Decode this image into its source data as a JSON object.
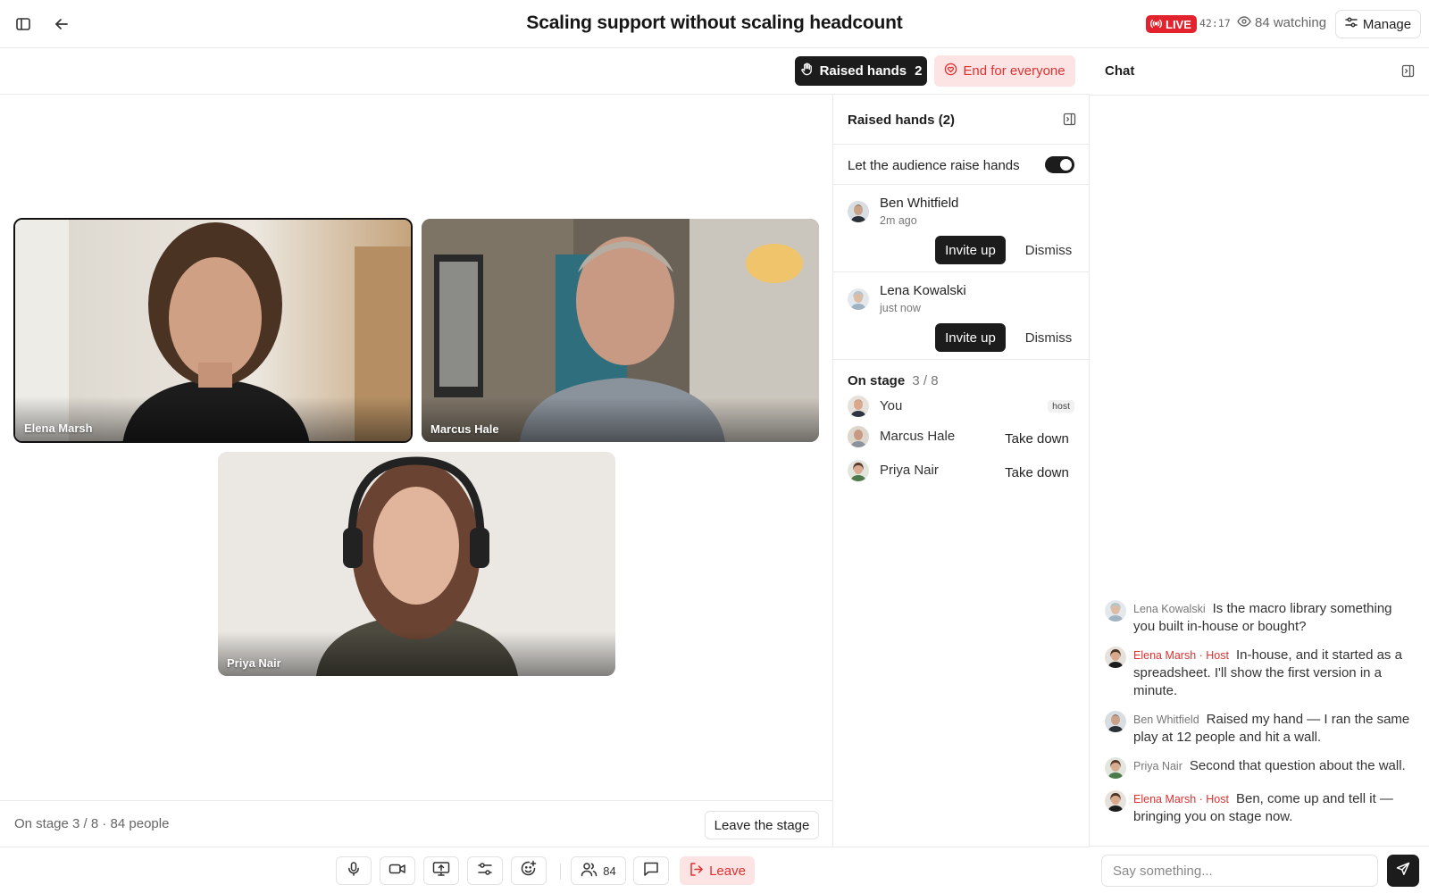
{
  "header": {
    "title": "Scaling support without scaling headcount",
    "live_label": "LIVE",
    "timer": "42:17",
    "watching": "84 watching",
    "manage_label": "Manage"
  },
  "stage_toolbar": {
    "raised_hands_label": "Raised hands",
    "raised_hands_count": "2",
    "end_label": "End for everyone"
  },
  "tiles": [
    {
      "name": "Elena Marsh",
      "speaking": true
    },
    {
      "name": "Marcus Hale",
      "speaking": false
    },
    {
      "name": "Priya Nair",
      "speaking": false
    }
  ],
  "stage_footer": {
    "summary": "On stage 3 / 8 · 84 people",
    "leave_stage_label": "Leave the stage"
  },
  "hands_panel": {
    "title": "Raised hands (2)",
    "toggle_label": "Let the audience raise hands",
    "toggle_on": true,
    "requests": [
      {
        "name": "Ben Whitfield",
        "time": "2m ago",
        "invite_label": "Invite up",
        "dismiss_label": "Dismiss"
      },
      {
        "name": "Lena Kowalski",
        "time": "just now",
        "invite_label": "Invite up",
        "dismiss_label": "Dismiss"
      }
    ],
    "on_stage_heading": "On stage",
    "on_stage_count": "3 / 8",
    "on_stage": [
      {
        "name": "You",
        "tag": "host"
      },
      {
        "name": "Marcus Hale",
        "action": "Take down"
      },
      {
        "name": "Priya Nair",
        "action": "Take down"
      }
    ]
  },
  "chat": {
    "title": "Chat",
    "messages": [
      {
        "author": "Lena Kowalski",
        "text": "Is the macro library something you built in-house or bought?",
        "host": false
      },
      {
        "author": "Elena Marsh · Host",
        "text": "In-house, and it started as a spreadsheet. I'll show the first version in a minute.",
        "host": true
      },
      {
        "author": "Ben Whitfield",
        "text": "Raised my hand — I ran the same play at 12 people and hit a wall.",
        "host": false
      },
      {
        "author": "Priya Nair",
        "text": "Second that question about the wall.",
        "host": false
      },
      {
        "author": "Elena Marsh · Host",
        "text": "Ben, come up and tell it — bringing you on stage now.",
        "host": true
      }
    ],
    "input_placeholder": "Say something..."
  },
  "controls": {
    "people_count": "84",
    "leave_label": "Leave"
  },
  "colors": {
    "accent_dark": "#1c1c1c",
    "live_red": "#e2222d",
    "danger_text": "#e03131",
    "danger_bg": "#fde4e4"
  }
}
